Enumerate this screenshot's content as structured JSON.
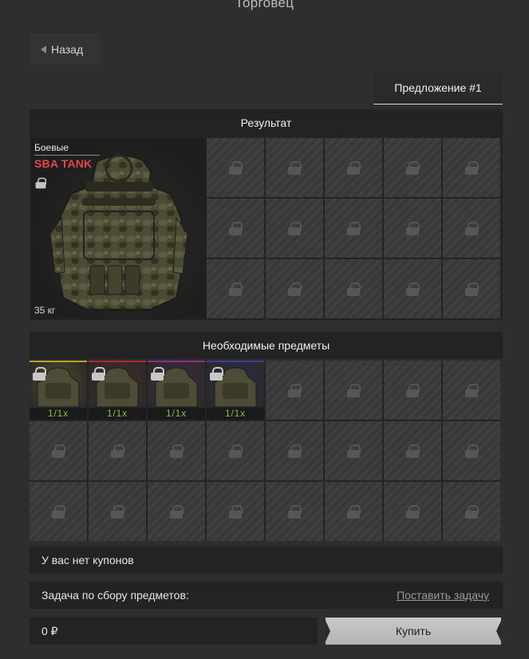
{
  "header": {
    "title": "Торговец"
  },
  "nav": {
    "back_label": "Назад"
  },
  "offer_tab": {
    "label": "Предложение #1"
  },
  "result": {
    "header": "Результат",
    "item": {
      "category": "Боевые",
      "name": "SBA TANK",
      "weight": "35 кг",
      "image_icon": "tactical-armor-vest-icon"
    }
  },
  "required": {
    "header": "Необходимые предметы",
    "items": [
      {
        "count": "1/1x",
        "rarity_color": "#b8a230",
        "image_icon": "armor-vest-icon"
      },
      {
        "count": "1/1x",
        "rarity_color": "#a82c2c",
        "image_icon": "armor-vest-icon"
      },
      {
        "count": "1/1x",
        "rarity_color": "#8d2e8e",
        "image_icon": "armor-vest-icon"
      },
      {
        "count": "1/1x",
        "rarity_color": "#3a3c9e",
        "image_icon": "armor-vest-icon"
      }
    ]
  },
  "coupons": {
    "text": "У вас нет купонов"
  },
  "task": {
    "label": "Задача по сбору предметов:",
    "link": "Поставить задачу"
  },
  "price": {
    "value": "0 ₽"
  },
  "buy": {
    "label": "Купить"
  },
  "colors": {
    "background": "#2e2e2e",
    "panel": "#232323",
    "item_name_red": "#e34848",
    "count_green": "#7fc04a",
    "buy_button": "#c0c0c0"
  }
}
